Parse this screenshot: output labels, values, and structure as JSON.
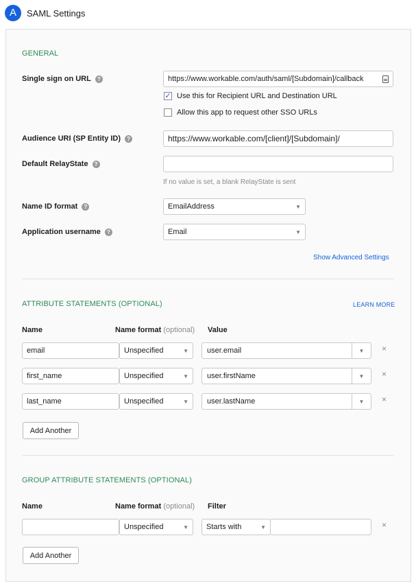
{
  "header": {
    "badge": "A",
    "title": "SAML Settings"
  },
  "general": {
    "section_title": "GENERAL",
    "sso_url": {
      "label": "Single sign on URL",
      "value": "https://www.workable.com/auth/saml/[Subdomain]/callback"
    },
    "recipient_checkbox": {
      "label": "Use this for Recipient URL and Destination URL",
      "checked": true
    },
    "other_sso_checkbox": {
      "label": "Allow this app to request other SSO URLs",
      "checked": false
    },
    "audience_uri": {
      "label": "Audience URI (SP Entity ID)",
      "value": "https://www.workable.com/[client]/[Subdomain]/"
    },
    "relay_state": {
      "label": "Default RelayState",
      "value": "",
      "hint": "If no value is set, a blank RelayState is sent"
    },
    "name_id_format": {
      "label": "Name ID format",
      "value": "EmailAddress"
    },
    "app_username": {
      "label": "Application username",
      "value": "Email"
    },
    "advanced_link": "Show Advanced Settings"
  },
  "attributes": {
    "section_title": "ATTRIBUTE STATEMENTS (OPTIONAL)",
    "learn_more": "LEARN MORE",
    "col_name": "Name",
    "col_format": "Name format",
    "col_format_opt": "(optional)",
    "col_value": "Value",
    "rows": [
      {
        "name": "email",
        "format": "Unspecified",
        "value": "user.email"
      },
      {
        "name": "first_name",
        "format": "Unspecified",
        "value": "user.firstName"
      },
      {
        "name": "last_name",
        "format": "Unspecified",
        "value": "user.lastName"
      }
    ],
    "add_button": "Add Another"
  },
  "group_attributes": {
    "section_title": "GROUP ATTRIBUTE STATEMENTS (OPTIONAL)",
    "col_name": "Name",
    "col_format": "Name format",
    "col_format_opt": "(optional)",
    "col_filter": "Filter",
    "row": {
      "name": "",
      "format": "Unspecified",
      "filter_type": "Starts with",
      "filter_value": ""
    },
    "add_button": "Add Another"
  },
  "icons": {
    "help": "?",
    "remove": "×",
    "dropdown": "▼",
    "check": "✓"
  }
}
